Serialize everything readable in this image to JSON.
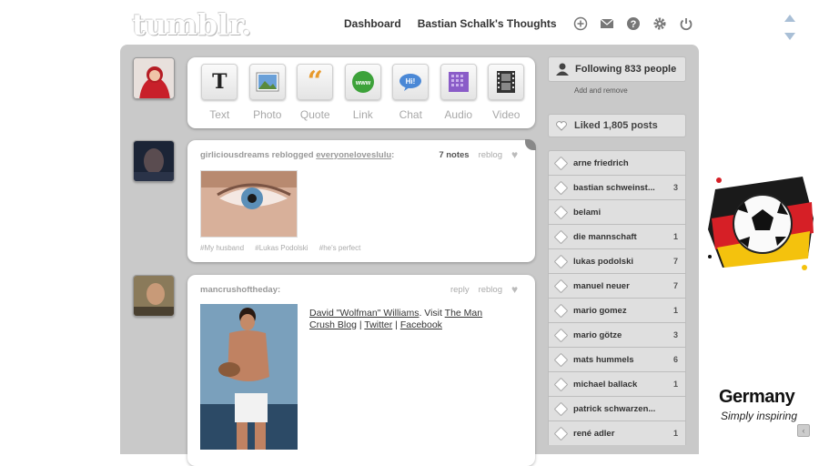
{
  "logo": "tumblr.",
  "topnav": {
    "dashboard": "Dashboard",
    "blog": "Bastian Schalk's Thoughts",
    "icons": [
      "new-post-icon",
      "inbox-icon",
      "help-icon",
      "preferences-icon",
      "logout-icon"
    ]
  },
  "post_types": [
    {
      "label": "Text",
      "icon": "text-icon"
    },
    {
      "label": "Photo",
      "icon": "photo-icon"
    },
    {
      "label": "Quote",
      "icon": "quote-icon"
    },
    {
      "label": "Link",
      "icon": "link-icon"
    },
    {
      "label": "Chat",
      "icon": "chat-icon"
    },
    {
      "label": "Audio",
      "icon": "audio-icon"
    },
    {
      "label": "Video",
      "icon": "video-icon"
    }
  ],
  "posts": [
    {
      "author": "girliciousdreams",
      "action": "reblogged",
      "source": "everyoneloveslulu",
      "notes": "7 notes",
      "reblog": "reblog",
      "tags": [
        "#My husband",
        "#Lukas Podolski",
        "#he's perfect"
      ]
    },
    {
      "author": "mancrushoftheday:",
      "reply": "reply",
      "reblog": "reblog",
      "caption": {
        "link1": "David \"Wolfman\" Williams",
        "visit": ". Visit ",
        "link2": "The Man Crush Blog",
        "sep": " | ",
        "link3": "Twitter",
        "link4": "Facebook"
      }
    }
  ],
  "sidebar": {
    "following": "Following 833 people",
    "add_remove": "Add and remove",
    "liked": "Liked 1,805 posts",
    "tags": [
      {
        "name": "arne friedrich",
        "count": ""
      },
      {
        "name": "bastian schweinst...",
        "count": "3"
      },
      {
        "name": "belami",
        "count": ""
      },
      {
        "name": "die mannschaft",
        "count": "1"
      },
      {
        "name": "lukas podolski",
        "count": "7"
      },
      {
        "name": "manuel neuer",
        "count": "7"
      },
      {
        "name": "mario gomez",
        "count": "1"
      },
      {
        "name": "mario götze",
        "count": "3"
      },
      {
        "name": "mats hummels",
        "count": "6"
      },
      {
        "name": "michael ballack",
        "count": "1"
      },
      {
        "name": "patrick schwarzen...",
        "count": ""
      },
      {
        "name": "rené adler",
        "count": "1"
      }
    ]
  },
  "ad": {
    "title": "Germany",
    "subtitle": "Simply inspiring"
  },
  "colors": {
    "dashboard_bg": "#c9c9c9",
    "sidebar_bg": "#e2e2e2"
  }
}
